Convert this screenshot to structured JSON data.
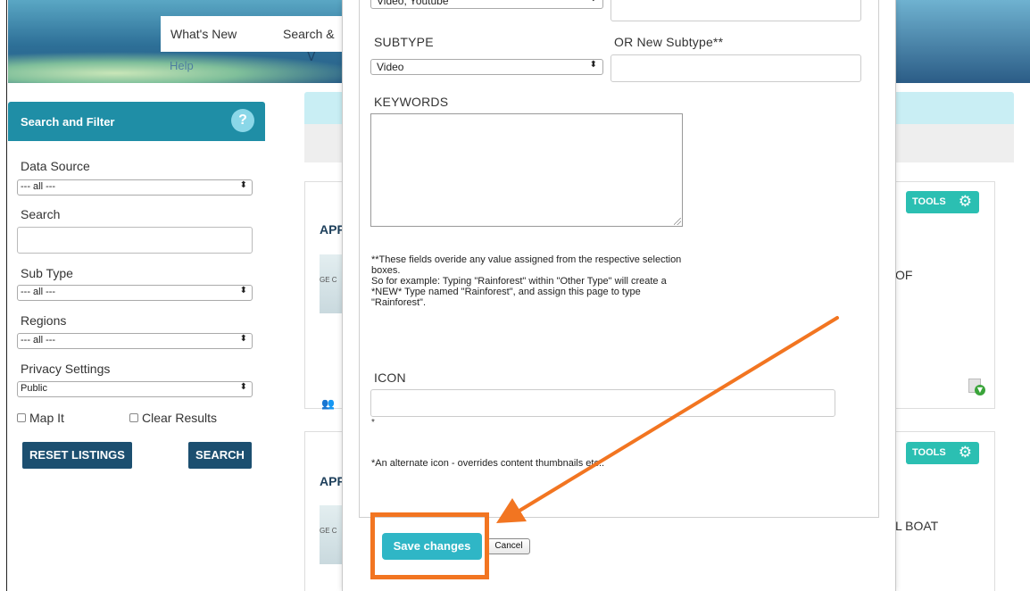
{
  "nav": {
    "tabs": [
      "What's New",
      "Search &"
    ],
    "help": "Help"
  },
  "sidebar": {
    "title": "Search and Filter",
    "help_glyph": "?",
    "data_source": {
      "label": "Data Source",
      "value": "--- all ---"
    },
    "search": {
      "label": "Search",
      "value": ""
    },
    "sub_type": {
      "label": "Sub Type",
      "value": "--- all ---"
    },
    "regions": {
      "label": "Regions",
      "value": "--- all ---"
    },
    "privacy": {
      "label": "Privacy Settings",
      "value": "Public"
    },
    "map_it": "Map It",
    "clear_results": "Clear Results",
    "reset_button": "RESET LISTINGS",
    "search_button": "SEARCH"
  },
  "listings": [
    {
      "title_fragment": "APP",
      "thumb_text": "GE C",
      "tools": "TOOLS",
      "right_text": "OF"
    },
    {
      "title_fragment": "APP",
      "thumb_text": "GE C",
      "tools": "TOOLS",
      "right_text": "L BOAT"
    }
  ],
  "modal": {
    "type_value_partial": "Video, Youtube",
    "subtype_label": "SUBTYPE",
    "subtype_value": "Video",
    "new_subtype_label": "OR New Subtype**",
    "keywords_label": "KEYWORDS",
    "note_lines": [
      "**These fields overide any value assigned from the respective selection",
      "boxes.",
      "So for example: Typing \"Rainforest\" within \"Other Type\" will create a",
      "*NEW* Type named \"Rainforest\", and assign this page to type",
      "\"Rainforest\"."
    ],
    "icon_label": "ICON",
    "icon_star": "*",
    "icon_note": "*An alternate icon - overrides content thumbnails etc..",
    "save_button": "Save changes",
    "cancel_button": "Cancel"
  },
  "colors": {
    "annotation": "#f27521",
    "save_button": "#2fb6c6",
    "sidebar_header": "#1f8ea6",
    "dark_button": "#1c4f70",
    "tools_button": "#2bbfb2"
  }
}
